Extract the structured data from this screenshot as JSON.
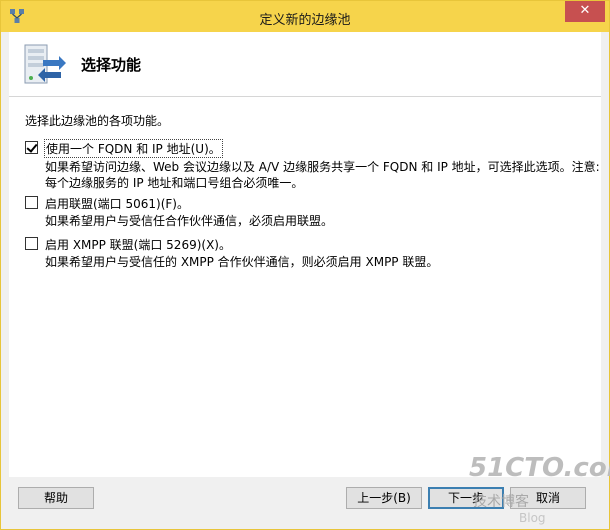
{
  "window": {
    "title": "定义新的边缘池",
    "close_label": "✕"
  },
  "header": {
    "title": "选择功能"
  },
  "content": {
    "intro": "选择此边缘池的各项功能。",
    "options": [
      {
        "label": "使用一个 FQDN 和 IP 地址(U)。",
        "checked": true,
        "description": "如果希望访问边缘、Web 会议边缘以及 A/V 边缘服务共享一个 FQDN 和 IP 地址，可选择此选项。注意: 每个边缘服务的 IP 地址和端口号组合必须唯一。"
      },
      {
        "label": "启用联盟(端口 5061)(F)。",
        "checked": false,
        "description": "如果希望用户与受信任合作伙伴通信，必须启用联盟。"
      },
      {
        "label": "启用 XMPP 联盟(端口 5269)(X)。",
        "checked": false,
        "description": "如果希望用户与受信任的 XMPP 合作伙伴通信，则必须启用 XMPP 联盟。"
      }
    ]
  },
  "buttons": {
    "help": "帮助",
    "back": "上一步(B)",
    "next": "下一步",
    "cancel": "取消"
  },
  "watermark": {
    "logo": "51CTO.com",
    "subtitle": "技术博客",
    "blog": "Blog"
  },
  "colors": {
    "titlebar": "#f6d44b",
    "close": "#c75050",
    "panel": "#ffffff",
    "chrome": "#f0f0f0"
  }
}
